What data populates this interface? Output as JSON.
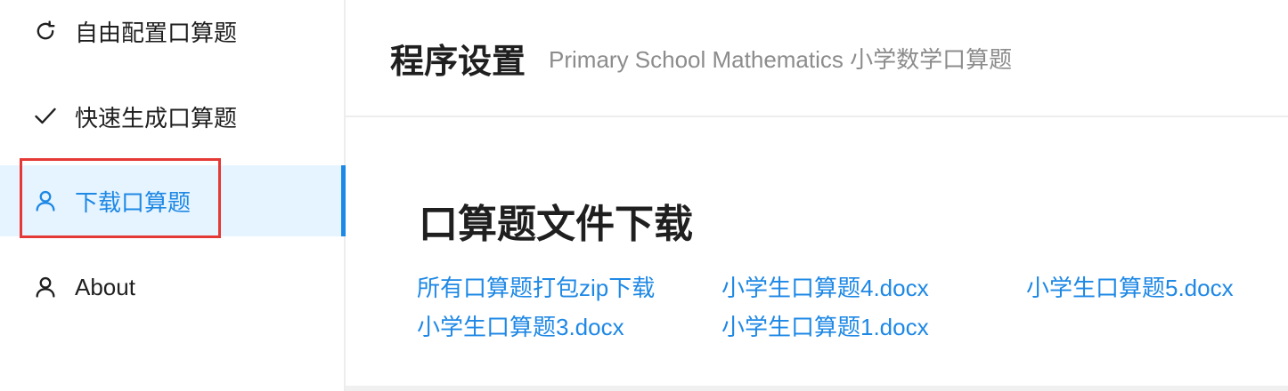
{
  "sidebar": {
    "items": [
      {
        "label": "自由配置口算题",
        "icon": "refresh-icon",
        "active": false
      },
      {
        "label": "快速生成口算题",
        "icon": "check-icon",
        "active": false
      },
      {
        "label": "下载口算题",
        "icon": "user-icon",
        "active": true
      },
      {
        "label": "About",
        "icon": "user-icon",
        "active": false
      }
    ]
  },
  "header": {
    "title": "程序设置",
    "subtitle": "Primary School Mathematics 小学数学口算题"
  },
  "main": {
    "section_title": "口算题文件下载",
    "files": [
      {
        "label": "所有口算题打包zip下载"
      },
      {
        "label": "小学生口算题4.docx"
      },
      {
        "label": "小学生口算题5.docx"
      },
      {
        "label": "小学生口算题3.docx"
      },
      {
        "label": "小学生口算题1.docx"
      }
    ]
  },
  "colors": {
    "accent": "#1e88e5",
    "active_bg": "#e6f4ff",
    "highlight": "#e53935"
  }
}
